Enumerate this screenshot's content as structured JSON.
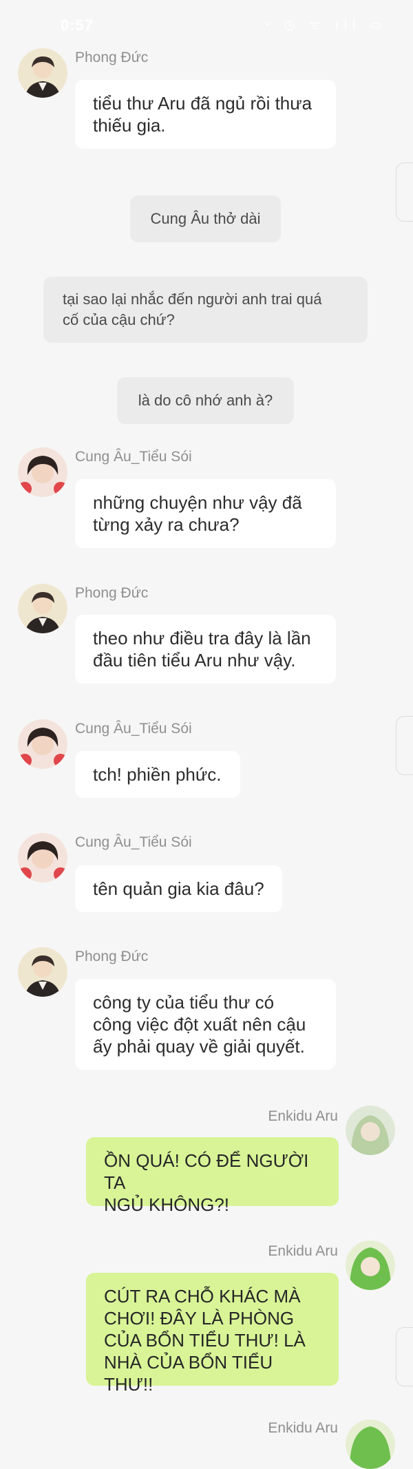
{
  "status": {
    "time": "0:57",
    "icons": "◔ ◷ ᯤ ıll ▭"
  },
  "messages": [
    {
      "sender": "Phong Đức",
      "text": "tiểu thư Aru đã ngủ rồi thưa\nthiếu gia."
    },
    {
      "narration": "Cung Âu thở dài"
    },
    {
      "narration": "tại sao lại nhắc đến người anh trai quá\ncố của cậu chứ?"
    },
    {
      "narration": "là do cô nhớ anh à?"
    },
    {
      "sender": "Cung Âu_Tiểu Sói",
      "text": "những chuyện như vậy đã\ntừng xảy ra chưa?"
    },
    {
      "sender": "Phong Đức",
      "text": "theo như điều tra đây là lần\nđầu tiên tiểu Aru như vậy."
    },
    {
      "sender": "Cung Âu_Tiểu Sói",
      "text": "tch! phiền phức."
    },
    {
      "sender": "Cung Âu_Tiểu Sói",
      "text": "tên quản gia kia đâu?"
    },
    {
      "sender": "Phong Đức",
      "text": "công ty của tiểu thư có\ncông việc đột xuất nên cậu\nấy phải quay về giải quyết."
    },
    {
      "sender": "Enkidu Aru",
      "text": "ỒN QUÁ! CÓ ĐỂ NGƯỜI TA\nNGỦ KHÔNG?!"
    },
    {
      "sender": "Enkidu Aru",
      "text": "CÚT RA CHỖ KHÁC MÀ\nCHƠI! ĐÂY LÀ PHÒNG\nCỦA BỔN TIỂU THƯ! LÀ\nNHÀ CỦA BỔN TIỂU THƯ!!"
    },
    {
      "sender": "Enkidu Aru"
    }
  ],
  "colors": {
    "background": "#f6f6f6",
    "bubble": "#ffffff",
    "self_bubble": "#d8f497",
    "narration": "#ebebeb",
    "name": "#8f8f8f"
  }
}
